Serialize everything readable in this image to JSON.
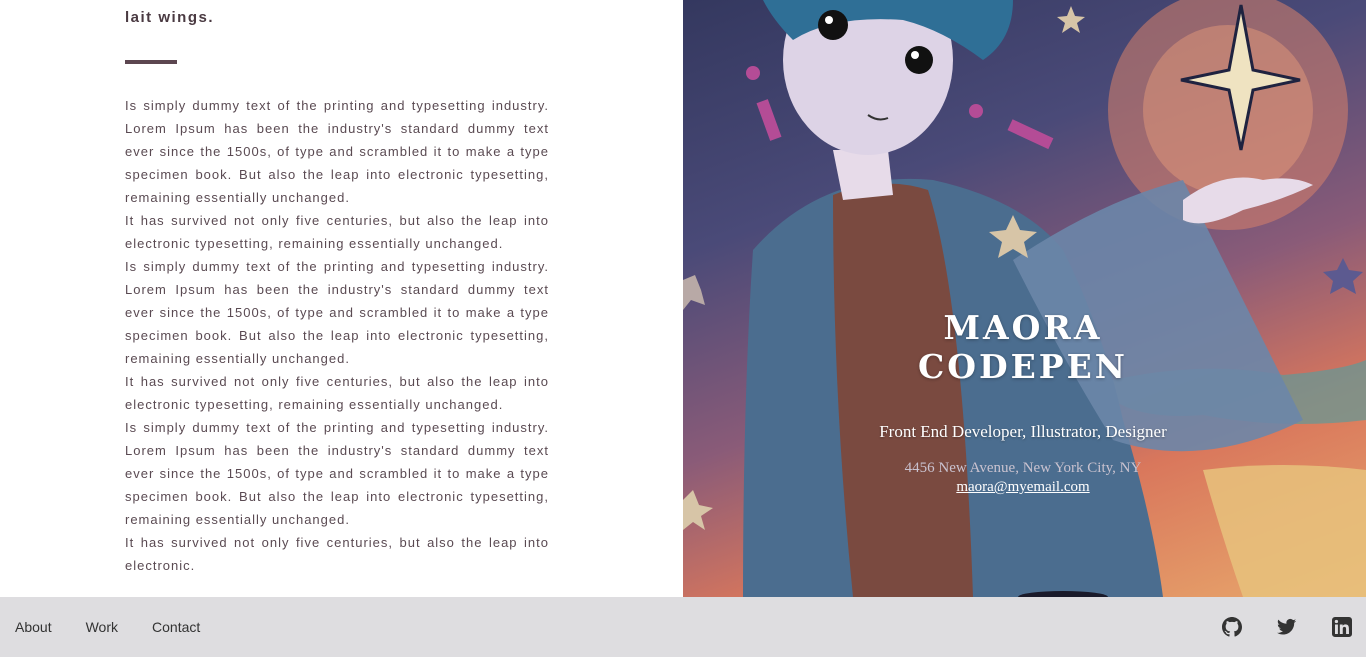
{
  "intro": {
    "heading_fragment": "lait wings."
  },
  "body": {
    "paragraphs": [
      "Is simply dummy text of the printing and typesetting industry. Lorem Ipsum has been the industry's standard dummy text ever since the 1500s, of type and scrambled it to make a type specimen book. But also the leap into electronic typesetting, remaining essentially unchanged.",
      "It has survived not only five centuries, but also the leap into electronic typesetting, remaining essentially unchanged.",
      "Is simply dummy text of the printing and typesetting industry. Lorem Ipsum has been the industry's standard dummy text ever since the 1500s, of type and scrambled it to make a type specimen book. But also the leap into electronic typesetting, remaining essentially unchanged.",
      "It has survived not only five centuries, but also the leap into electronic typesetting, remaining essentially unchanged.",
      "Is simply dummy text of the printing and typesetting industry. Lorem Ipsum has been the industry's standard dummy text ever since the 1500s, of type and scrambled it to make a type specimen book. But also the leap into electronic typesetting, remaining essentially unchanged.",
      "It has survived not only five centuries, but also the leap into electronic."
    ]
  },
  "hero": {
    "name": "MAORA CODEPEN",
    "role": "Front End Developer, Illustrator, Designer",
    "address": "4456 New Avenue, New York City, NY",
    "email": "maora@myemail.com"
  },
  "footer": {
    "nav": [
      {
        "label": "About"
      },
      {
        "label": "Work"
      },
      {
        "label": "Contact"
      }
    ],
    "social": [
      {
        "icon": "github-icon"
      },
      {
        "icon": "twitter-icon"
      },
      {
        "icon": "linkedin-icon"
      }
    ]
  },
  "colors": {
    "text_dark": "#5a4a52",
    "accent_rule": "#5c4650",
    "footer_bg": "#dedde0",
    "hero_text": "#ffffff"
  }
}
